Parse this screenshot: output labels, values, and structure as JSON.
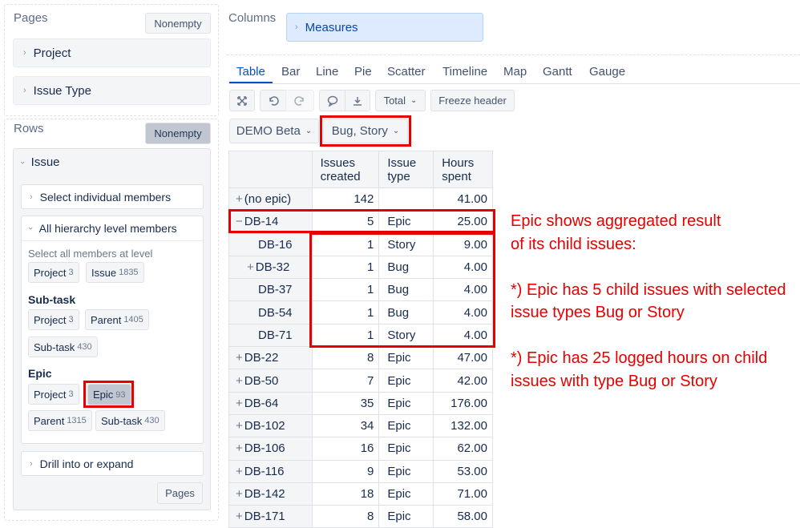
{
  "pages": {
    "title": "Pages",
    "nonempty_label": "Nonempty",
    "items": [
      {
        "label": "Project"
      },
      {
        "label": "Issue Type"
      }
    ]
  },
  "rows": {
    "title": "Rows",
    "nonempty_label": "Nonempty",
    "issue_label": "Issue",
    "select_individual": "Select individual members",
    "all_hierarchy": "All hierarchy level members",
    "select_all_text": "Select all members at level",
    "levels_top": [
      {
        "label": "Project",
        "count": "3"
      },
      {
        "label": "Issue",
        "count": "1835"
      }
    ],
    "subtask": {
      "title": "Sub-task",
      "items": [
        {
          "label": "Project",
          "count": "3"
        },
        {
          "label": "Parent",
          "count": "1405"
        },
        {
          "label": "Sub-task",
          "count": "430"
        }
      ]
    },
    "epic": {
      "title": "Epic",
      "items": [
        {
          "label": "Project",
          "count": "3"
        },
        {
          "label": "Epic",
          "count": "93"
        },
        {
          "label": "Parent",
          "count": "1315"
        },
        {
          "label": "Sub-task",
          "count": "430"
        }
      ]
    },
    "drill": "Drill into or expand",
    "pages_button": "Pages"
  },
  "columns": {
    "title": "Columns",
    "measures": "Measures"
  },
  "tabs": [
    {
      "label": "Table",
      "active": true
    },
    {
      "label": "Bar"
    },
    {
      "label": "Line"
    },
    {
      "label": "Pie"
    },
    {
      "label": "Scatter"
    },
    {
      "label": "Timeline"
    },
    {
      "label": "Map"
    },
    {
      "label": "Gantt"
    },
    {
      "label": "Gauge"
    }
  ],
  "toolbar": {
    "total": "Total",
    "freeze": "Freeze header"
  },
  "filters": {
    "project": "DEMO Beta",
    "issue_type": "Bug, Story"
  },
  "table": {
    "headers": [
      {
        "line1": "Issues",
        "line2": "created"
      },
      {
        "line1": "Issue",
        "line2": "type"
      },
      {
        "line1": "Hours",
        "line2": "spent"
      }
    ],
    "rows": [
      {
        "expander": "+",
        "name": "(no epic)",
        "created": "142",
        "type": "",
        "hours": "41.00"
      },
      {
        "expander": "−",
        "name": "DB-14",
        "created": "5",
        "type": "Epic",
        "hours": "25.00"
      },
      {
        "expander": "",
        "name": "DB-16",
        "created": "1",
        "type": "Story",
        "hours": "9.00"
      },
      {
        "expander": "+",
        "name": "DB-32",
        "created": "1",
        "type": "Bug",
        "hours": "4.00"
      },
      {
        "expander": "",
        "name": "DB-37",
        "created": "1",
        "type": "Bug",
        "hours": "4.00"
      },
      {
        "expander": "",
        "name": "DB-54",
        "created": "1",
        "type": "Bug",
        "hours": "4.00"
      },
      {
        "expander": "",
        "name": "DB-71",
        "created": "1",
        "type": "Story",
        "hours": "4.00"
      },
      {
        "expander": "+",
        "name": "DB-22",
        "created": "8",
        "type": "Epic",
        "hours": "47.00"
      },
      {
        "expander": "+",
        "name": "DB-50",
        "created": "7",
        "type": "Epic",
        "hours": "42.00"
      },
      {
        "expander": "+",
        "name": "DB-64",
        "created": "35",
        "type": "Epic",
        "hours": "176.00"
      },
      {
        "expander": "+",
        "name": "DB-102",
        "created": "34",
        "type": "Epic",
        "hours": "132.00"
      },
      {
        "expander": "+",
        "name": "DB-106",
        "created": "16",
        "type": "Epic",
        "hours": "62.00"
      },
      {
        "expander": "+",
        "name": "DB-116",
        "created": "9",
        "type": "Epic",
        "hours": "53.00"
      },
      {
        "expander": "+",
        "name": "DB-142",
        "created": "18",
        "type": "Epic",
        "hours": "71.00"
      },
      {
        "expander": "+",
        "name": "DB-171",
        "created": "8",
        "type": "Epic",
        "hours": "58.00"
      }
    ]
  },
  "annotation": {
    "line1": "Epic shows aggregated result",
    "line2": "of its child issues:",
    "line3": "*) Epic has 5 child issues with selected",
    "line4": "issue types Bug or Story",
    "line5": "*) Epic has 25 logged hours on child",
    "line6": "issues with type Bug or Story"
  },
  "colors": {
    "annotation": "#e60000",
    "active_tab": "#0052cc",
    "measures_bg": "#deebff"
  }
}
